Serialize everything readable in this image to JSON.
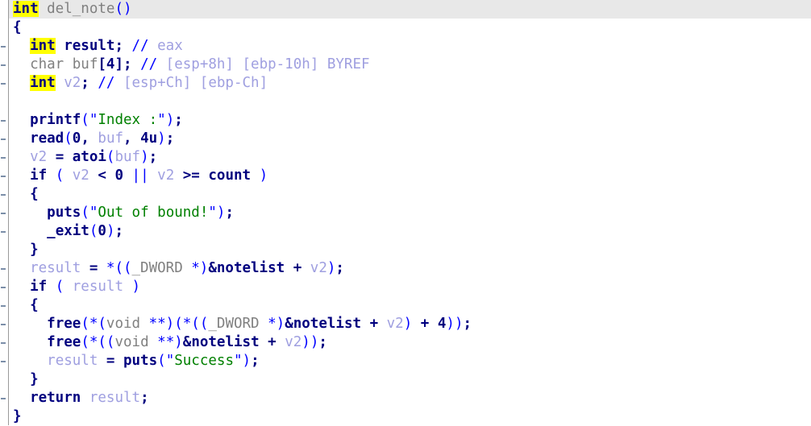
{
  "view": {
    "name": "ida-pseudocode-view",
    "title": "del_note pseudocode",
    "background": "#ffffff",
    "current_line_highlight": "#e8e8e8",
    "keyword_highlight": "#ffff00"
  },
  "colors": {
    "keyword": "#00007f",
    "function": "#00007f",
    "global": "#00007f",
    "local_var": "#9f9fe0",
    "type": "#808080",
    "string": "#008000",
    "quote": "#0000ff",
    "comment_marker": "#0000ff",
    "comment_text": "#9f9fe0",
    "paren": "#0000ff",
    "highlight_bg": "#ffff00",
    "current_line_bg": "#e8e8e8",
    "gutter_border": "#9a9a9a",
    "gutter_mark": "#7b8ea8"
  },
  "code": {
    "function_signature": "int del_note()",
    "lines": [
      {
        "n": 1,
        "text": "int del_note()",
        "current": true,
        "gutter": false
      },
      {
        "n": 2,
        "text": "{",
        "current": false,
        "gutter": false
      },
      {
        "n": 3,
        "text": "  int result; // eax",
        "current": false,
        "gutter": true
      },
      {
        "n": 4,
        "text": "  char buf[4]; // [esp+8h] [ebp-10h] BYREF",
        "current": false,
        "gutter": true
      },
      {
        "n": 5,
        "text": "  int v2; // [esp+Ch] [ebp-Ch]",
        "current": false,
        "gutter": true
      },
      {
        "n": 6,
        "text": "",
        "current": false,
        "gutter": false
      },
      {
        "n": 7,
        "text": "  printf(\"Index :\");",
        "current": false,
        "gutter": true
      },
      {
        "n": 8,
        "text": "  read(0, buf, 4u);",
        "current": false,
        "gutter": true
      },
      {
        "n": 9,
        "text": "  v2 = atoi(buf);",
        "current": false,
        "gutter": true
      },
      {
        "n": 10,
        "text": "  if ( v2 < 0 || v2 >= count )",
        "current": false,
        "gutter": true
      },
      {
        "n": 11,
        "text": "  {",
        "current": false,
        "gutter": true
      },
      {
        "n": 12,
        "text": "    puts(\"Out of bound!\");",
        "current": false,
        "gutter": true
      },
      {
        "n": 13,
        "text": "    _exit(0);",
        "current": false,
        "gutter": true
      },
      {
        "n": 14,
        "text": "  }",
        "current": false,
        "gutter": false
      },
      {
        "n": 15,
        "text": "  result = *((_DWORD *)&notelist + v2);",
        "current": false,
        "gutter": true
      },
      {
        "n": 16,
        "text": "  if ( result )",
        "current": false,
        "gutter": true
      },
      {
        "n": 17,
        "text": "  {",
        "current": false,
        "gutter": true
      },
      {
        "n": 18,
        "text": "    free(*(void **)(*((_DWORD *)&notelist + v2) + 4));",
        "current": false,
        "gutter": true
      },
      {
        "n": 19,
        "text": "    free(*((void **)&notelist + v2));",
        "current": false,
        "gutter": true
      },
      {
        "n": 20,
        "text": "    result = puts(\"Success\");",
        "current": false,
        "gutter": true
      },
      {
        "n": 21,
        "text": "  }",
        "current": false,
        "gutter": false
      },
      {
        "n": 22,
        "text": "  return result;",
        "current": false,
        "gutter": true
      },
      {
        "n": 23,
        "text": "}",
        "current": false,
        "gutter": false
      }
    ],
    "identifiers": {
      "function_name": "del_note",
      "locals": [
        "result",
        "buf",
        "v2"
      ],
      "globals": [
        "notelist",
        "count"
      ],
      "calls": [
        "printf",
        "read",
        "atoi",
        "puts",
        "_exit",
        "free"
      ],
      "strings": [
        "Index :",
        "Out of bound!",
        "Success"
      ],
      "comments": [
        "eax",
        "[esp+8h] [ebp-10h] BYREF",
        "[esp+Ch] [ebp-Ch]"
      ],
      "types": [
        "int",
        "char",
        "void",
        "_DWORD"
      ],
      "highlighted_token": "int"
    }
  }
}
